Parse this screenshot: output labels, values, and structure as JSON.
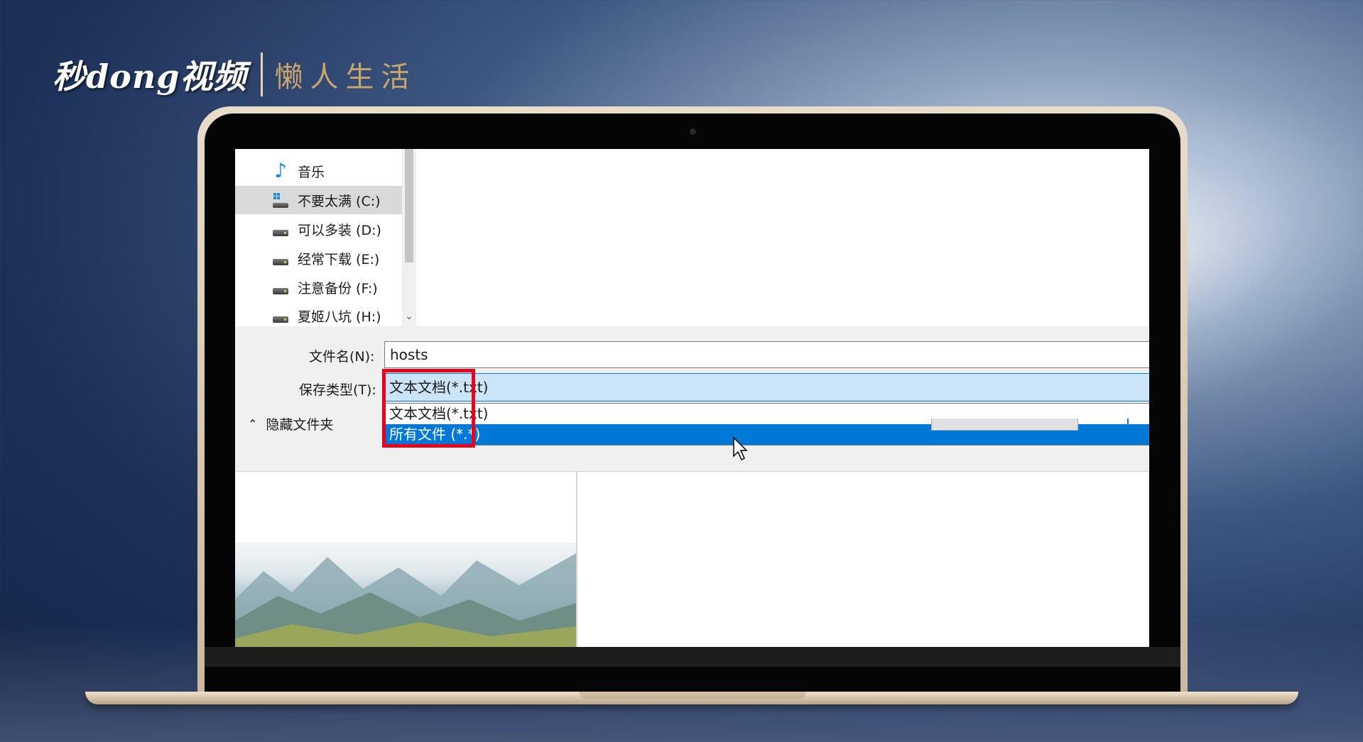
{
  "branding": {
    "logo_main": "秒dong视频",
    "logo_sub": "懒人生活"
  },
  "nav": {
    "items": [
      {
        "label": "音乐",
        "icon": "music-note-icon"
      },
      {
        "label": "不要太满 (C:)",
        "icon": "windows-drive-icon",
        "selected": true
      },
      {
        "label": "可以多装 (D:)",
        "icon": "drive-icon"
      },
      {
        "label": "经常下载 (E:)",
        "icon": "drive-icon"
      },
      {
        "label": "注意备份 (F:)",
        "icon": "drive-icon"
      },
      {
        "label": "夏姬八坑 (H:)",
        "icon": "drive-icon"
      }
    ]
  },
  "save_dialog": {
    "filename_label": "文件名(N):",
    "filename_value": "hosts",
    "type_label": "保存类型(T):",
    "type_selected": "文本文档(*.txt)",
    "type_options": [
      "文本文档(*.txt)",
      "所有文件 (*.*)"
    ],
    "hide_folders_label": "隐藏文件夹"
  },
  "colors": {
    "highlight": "#0078d7",
    "annotation_box": "#e8001c",
    "select_bg": "#cce4f7"
  }
}
